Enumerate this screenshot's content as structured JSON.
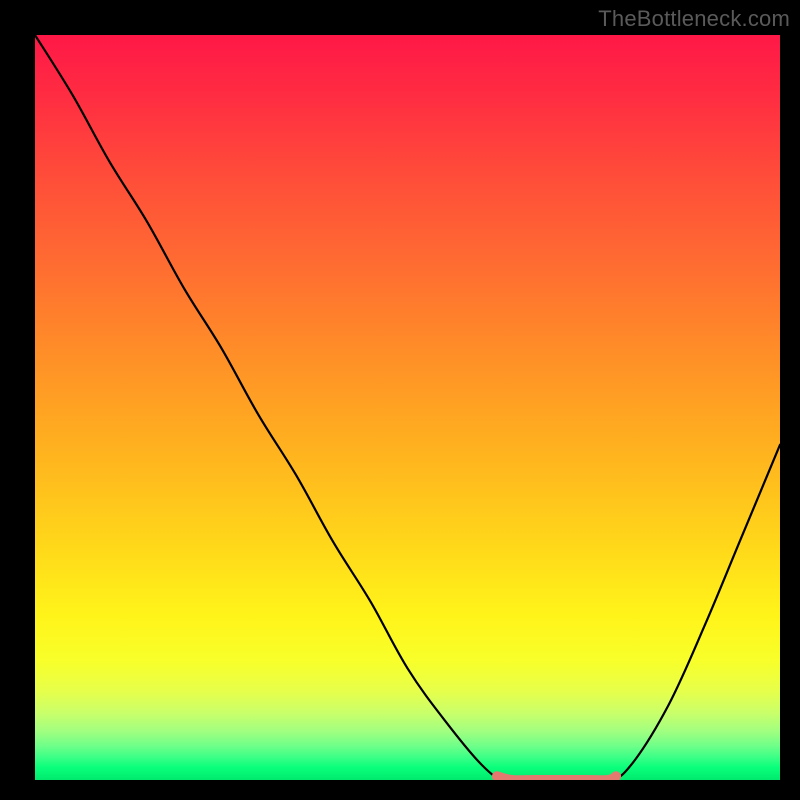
{
  "watermark": "TheBottleneck.com",
  "chart_data": {
    "type": "line",
    "title": "",
    "xlabel": "",
    "ylabel": "",
    "xlim": [
      0,
      1
    ],
    "ylim": [
      0,
      1
    ],
    "background_gradient_stops": [
      {
        "pos": 0.0,
        "color": "#ff1847"
      },
      {
        "pos": 0.18,
        "color": "#ff4a3a"
      },
      {
        "pos": 0.42,
        "color": "#ff8c28"
      },
      {
        "pos": 0.68,
        "color": "#ffd61a"
      },
      {
        "pos": 0.84,
        "color": "#f8ff2a"
      },
      {
        "pos": 0.93,
        "color": "#a0ff80"
      },
      {
        "pos": 1.0,
        "color": "#00ea6e"
      }
    ],
    "series": [
      {
        "name": "bottleneck-curve",
        "color": "#000000",
        "x": [
          0.0,
          0.05,
          0.1,
          0.15,
          0.2,
          0.25,
          0.3,
          0.35,
          0.4,
          0.45,
          0.5,
          0.55,
          0.6,
          0.63,
          0.67,
          0.72,
          0.77,
          0.8,
          0.85,
          0.9,
          0.95,
          1.0
        ],
        "y": [
          1.0,
          0.92,
          0.83,
          0.75,
          0.66,
          0.58,
          0.49,
          0.41,
          0.32,
          0.24,
          0.15,
          0.08,
          0.02,
          0.0,
          0.0,
          0.0,
          0.0,
          0.02,
          0.1,
          0.21,
          0.33,
          0.45
        ]
      },
      {
        "name": "valley-highlight",
        "color": "#e47a6f",
        "x": [
          0.62,
          0.64,
          0.67,
          0.7,
          0.74,
          0.77,
          0.78
        ],
        "y": [
          0.005,
          0.0,
          0.0,
          0.0,
          0.0,
          0.0,
          0.005
        ]
      }
    ],
    "annotations": []
  }
}
